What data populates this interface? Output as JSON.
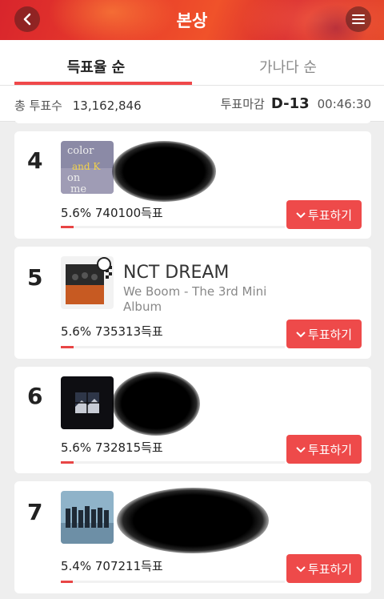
{
  "header": {
    "title": "본상",
    "back_icon": "chevron-left-icon",
    "menu_icon": "hamburger-menu-icon"
  },
  "tabs": [
    {
      "label": "득표율 순",
      "active": true
    },
    {
      "label": "가나다 순",
      "active": false
    }
  ],
  "summary": {
    "total_label": "총 투표수",
    "total_value": "13,162,846",
    "deadline_label": "투표마감",
    "dday": "D-13",
    "time_left": "00:46:30"
  },
  "entries": [
    {
      "rank": "4",
      "artist": "",
      "album": "",
      "votes_text": "5.6% 740100득표",
      "share": 0.056,
      "button": "투표하기"
    },
    {
      "rank": "5",
      "artist": "NCT DREAM",
      "album": "We Boom - The 3rd Mini Album",
      "votes_text": "5.6% 735313득표",
      "share": 0.056,
      "button": "투표하기"
    },
    {
      "rank": "6",
      "artist": "",
      "album": "",
      "votes_text": "5.6% 732815득표",
      "share": 0.056,
      "button": "투표하기"
    },
    {
      "rank": "7",
      "artist": "",
      "album": "",
      "votes_text": "5.4% 707211득표",
      "share": 0.054,
      "button": "투표하기"
    }
  ],
  "colors": {
    "accent": "#ee4a4a",
    "header_red": "#e73a2b"
  }
}
